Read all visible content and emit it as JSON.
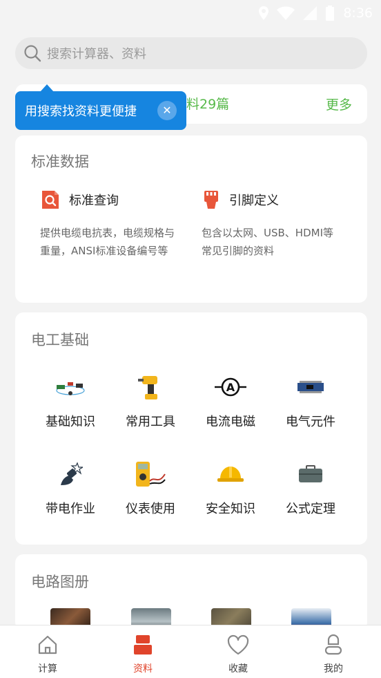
{
  "status_bar": {
    "time": "8:36"
  },
  "search": {
    "placeholder": "搜索计算器、资料"
  },
  "notice": {
    "text": "料29篇",
    "more": "更多"
  },
  "tooltip": {
    "text": "用搜索找资料更便捷",
    "close_symbol": "✕"
  },
  "standard_data": {
    "title": "标准数据",
    "items": [
      {
        "name": "标准查询",
        "desc": "提供电缆电抗表，电缆规格与重量，ANSI标准设备编号等",
        "icon": "search-doc-icon"
      },
      {
        "name": "引脚定义",
        "desc": "包含以太网、USB、HDMI等常见引脚的资料",
        "icon": "connector-icon"
      }
    ]
  },
  "electric_basics": {
    "title": "电工基础",
    "items": [
      {
        "label": "基础知识",
        "icon": "circuit-wire-icon"
      },
      {
        "label": "常用工具",
        "icon": "drill-icon"
      },
      {
        "label": "电流电磁",
        "icon": "ammeter-icon"
      },
      {
        "label": "电气元件",
        "icon": "circuit-board-icon"
      },
      {
        "label": "带电作业",
        "icon": "plug-spark-icon"
      },
      {
        "label": "仪表使用",
        "icon": "multimeter-icon"
      },
      {
        "label": "安全知识",
        "icon": "hard-hat-icon"
      },
      {
        "label": "公式定理",
        "icon": "toolbox-icon"
      }
    ]
  },
  "circuits": {
    "title": "电路图册"
  },
  "bottom_nav": {
    "items": [
      {
        "label": "计算",
        "icon": "home-icon",
        "active": false
      },
      {
        "label": "资料",
        "icon": "folder-icon",
        "active": true
      },
      {
        "label": "收藏",
        "icon": "heart-icon",
        "active": false
      },
      {
        "label": "我的",
        "icon": "user-icon",
        "active": false
      }
    ]
  },
  "colors": {
    "accent_green": "#57b94a",
    "tooltip_blue": "#1685e0",
    "active_red": "#e0442b"
  }
}
